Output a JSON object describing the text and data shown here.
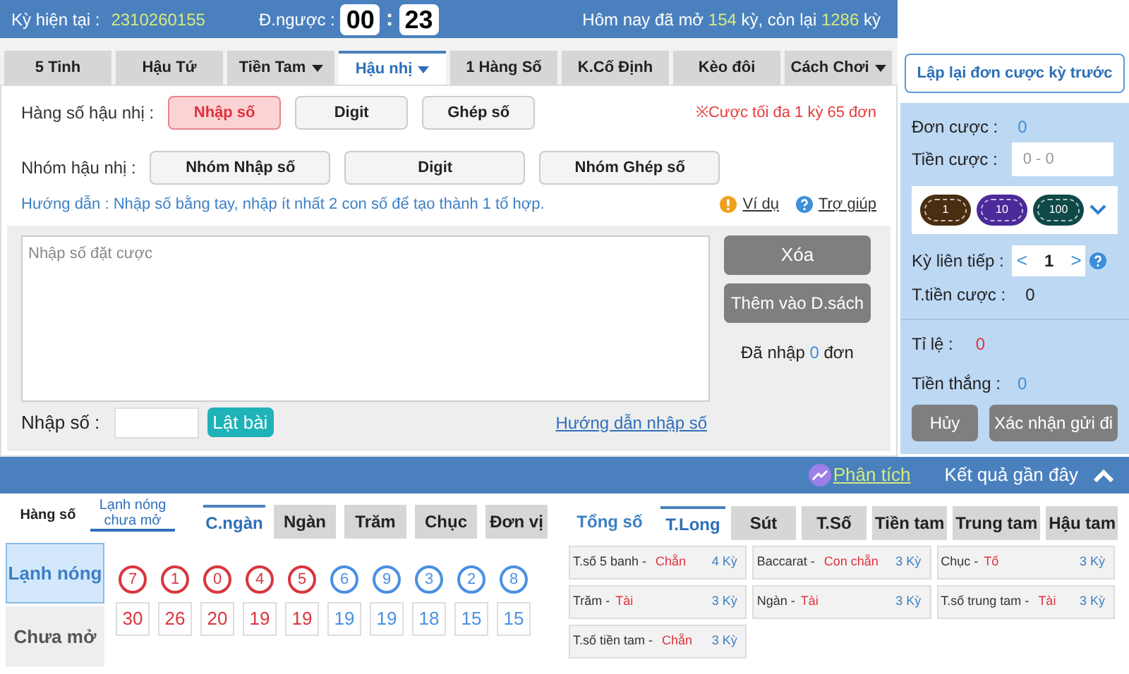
{
  "header": {
    "current_label": "Kỳ hiện tại  :",
    "current_value": "2310260155",
    "countdown_label": "Đ.ngược :",
    "countdown": [
      "00",
      "23"
    ],
    "countdown_sep": ":",
    "summary": [
      {
        "text": "Hôm nay đã mở ",
        "highlight": false
      },
      {
        "text": "154",
        "highlight": true
      },
      {
        "text": " kỳ, còn lại ",
        "highlight": false
      },
      {
        "text": "1286",
        "highlight": true
      },
      {
        "text": " kỳ",
        "highlight": false
      }
    ]
  },
  "tabs": [
    {
      "label": "5 Tinh",
      "selected": false,
      "dropdown": false
    },
    {
      "label": "Hậu Tứ",
      "selected": false,
      "dropdown": false
    },
    {
      "label": "Tiền Tam",
      "selected": false,
      "dropdown": true
    },
    {
      "label": "Hậu nhị",
      "selected": true,
      "dropdown": true
    },
    {
      "label": "1 Hàng Số",
      "selected": false,
      "dropdown": false
    },
    {
      "label": "K.Cố Định",
      "selected": false,
      "dropdown": false
    },
    {
      "label": "Kèo đôi",
      "selected": false,
      "dropdown": false
    },
    {
      "label": "Cách Chơi",
      "selected": false,
      "dropdown": true
    }
  ],
  "option_rows": [
    {
      "label": "Hàng số hậu nhị :",
      "options": [
        {
          "label": "Nhập số",
          "selected": true
        },
        {
          "label": "Digit",
          "selected": false
        },
        {
          "label": "Ghép số",
          "selected": false
        }
      ]
    },
    {
      "label": "Nhóm hậu nhị :",
      "options": [
        {
          "label": "Nhóm Nhập số",
          "selected": false
        },
        {
          "label": "Digit",
          "selected": false
        },
        {
          "label": "Nhóm Ghép số",
          "selected": false
        }
      ]
    }
  ],
  "limit_note": "※Cược tối đa 1 kỳ 65 đơn",
  "guide": "Hướng dẫn : Nhập số bằng tay, nhập ít nhất 2 con số để tạo thành 1 tổ hợp.",
  "example_link": "Ví dụ",
  "help_link": "Trợ giúp",
  "bet_input": {
    "placeholder": "Nhập số đặt cược"
  },
  "clear_button": "Xóa",
  "add_button": "Thêm vào D.sách",
  "entered": [
    {
      "text": "Đã nhập ",
      "highlight": false
    },
    {
      "text": "0",
      "highlight": true
    },
    {
      "text": " đơn",
      "highlight": false
    }
  ],
  "number_label": "Nhập số :",
  "flip_button": "Lật bài",
  "input_guide_link": "Hướng dẫn nhập số",
  "sidebar": {
    "repeat_button": "Lập lại đơn cược kỳ trước",
    "bet_count_label": "Đơn cược :",
    "bet_count": "0",
    "bet_amount_label": "Tiền cược :",
    "bet_amount_placeholder": "0 - 0",
    "chips": [
      {
        "label": "1",
        "color": "#4a2e12"
      },
      {
        "label": "10",
        "color": "#4b2a9a"
      },
      {
        "label": "100",
        "color": "#0f4a48"
      }
    ],
    "consecutive_label": "Kỳ liên tiếp :",
    "prev": "<",
    "consecutive": "1",
    "next": ">",
    "total_label": "T.tiền cược :",
    "total": "0",
    "ratio_label": "Tỉ lệ :",
    "ratio": "0",
    "win_label": "Tiền thắng :",
    "win": "0",
    "cancel_button": "Hủy",
    "confirm_button": "Xác nhận gửi đi"
  },
  "results_bar": {
    "analysis_link": "Phân tích",
    "title": "Kết quả gần đây",
    "expanded": true
  },
  "hotcold": {
    "modes": [
      {
        "label": "Hàng số",
        "selected": false
      },
      {
        "label": "Lạnh nóng chưa mở",
        "selected": true
      }
    ],
    "positions": [
      {
        "label": "C.ngàn",
        "selected": true
      },
      {
        "label": "Ngàn",
        "selected": false
      },
      {
        "label": "Trăm",
        "selected": false
      },
      {
        "label": "Chục",
        "selected": false
      },
      {
        "label": "Đơn vị",
        "selected": false
      }
    ],
    "row_labels": [
      {
        "label": "Lạnh nóng",
        "selected": true
      },
      {
        "label": "Chưa mở",
        "selected": false
      }
    ],
    "numbers": [
      {
        "digit": "7",
        "count": "30",
        "color": "#d9363e"
      },
      {
        "digit": "1",
        "count": "26",
        "color": "#d9363e"
      },
      {
        "digit": "0",
        "count": "20",
        "color": "#d9363e"
      },
      {
        "digit": "4",
        "count": "19",
        "color": "#d9363e"
      },
      {
        "digit": "5",
        "count": "19",
        "color": "#d9363e"
      },
      {
        "digit": "6",
        "count": "19",
        "color": "#4a90e2"
      },
      {
        "digit": "9",
        "count": "19",
        "color": "#4a90e2"
      },
      {
        "digit": "3",
        "count": "18",
        "color": "#4a90e2"
      },
      {
        "digit": "2",
        "count": "15",
        "color": "#4a90e2"
      },
      {
        "digit": "8",
        "count": "15",
        "color": "#4a90e2"
      }
    ]
  },
  "streaks": {
    "tabs": [
      {
        "label": "Tổng số",
        "selected": false,
        "kind": "heading"
      },
      {
        "label": "T.Long",
        "selected": true,
        "kind": "tab"
      },
      {
        "label": "Sút",
        "selected": false,
        "kind": "tab"
      },
      {
        "label": "T.Số",
        "selected": false,
        "kind": "tab"
      },
      {
        "label": "Tiền tam",
        "selected": false,
        "kind": "tab"
      },
      {
        "label": "Trung tam",
        "selected": false,
        "kind": "tab"
      },
      {
        "label": "Hậu tam",
        "selected": false,
        "kind": "tab"
      }
    ],
    "cards": [
      {
        "label": "T.số 5 banh - ",
        "result": "Chẵn",
        "streak": "4 Kỳ"
      },
      {
        "label": "Baccarat - ",
        "result": "Con chẵn",
        "streak": "3 Kỳ"
      },
      {
        "label": "Chục -",
        "result": "Tố",
        "streak": "3 Kỳ"
      },
      {
        "label": "Trăm -",
        "result": "Tài",
        "streak": "3 Kỳ"
      },
      {
        "label": "Ngàn -",
        "result": "Tài",
        "streak": "3 Kỳ"
      },
      {
        "label": "T.số trung tam - ",
        "result": "Tài",
        "streak": "3 Kỳ"
      },
      {
        "label": "T.số tiền tam - ",
        "result": "Chẵn",
        "streak": "3 Kỳ"
      }
    ]
  }
}
